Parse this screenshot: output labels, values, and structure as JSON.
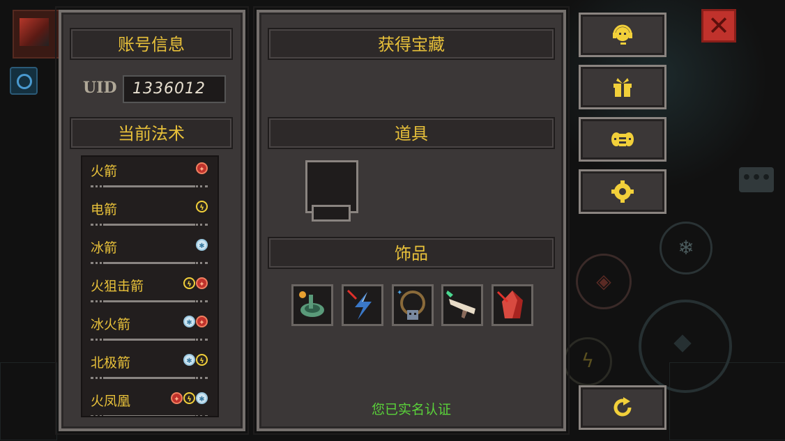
{
  "account": {
    "title": "账号信息",
    "uid_label": "UID",
    "uid_value": "1336012"
  },
  "spells": {
    "title": "当前法术",
    "items": [
      {
        "name": "火箭",
        "elements": [
          "fire"
        ]
      },
      {
        "name": "电箭",
        "elements": [
          "thunder"
        ]
      },
      {
        "name": "冰箭",
        "elements": [
          "ice"
        ]
      },
      {
        "name": "火狙击箭",
        "elements": [
          "thunder",
          "fire"
        ]
      },
      {
        "name": "冰火箭",
        "elements": [
          "ice",
          "fire"
        ]
      },
      {
        "name": "北极箭",
        "elements": [
          "ice",
          "thunder"
        ]
      },
      {
        "name": "火凤凰",
        "elements": [
          "fire",
          "thunder",
          "ice"
        ]
      }
    ]
  },
  "treasure": {
    "title": "获得宝藏",
    "props_title": "道具",
    "accessories_title": "饰品",
    "accessories": [
      {
        "icon": "coiled-snake-amulet-icon"
      },
      {
        "icon": "lightning-bolt-charm-icon"
      },
      {
        "icon": "skull-necklace-icon"
      },
      {
        "icon": "bone-horn-icon"
      },
      {
        "icon": "red-crystal-icon"
      }
    ],
    "verified_text": "您已实名认证"
  },
  "side_buttons": [
    {
      "icon": "customer-service-icon"
    },
    {
      "icon": "gift-icon"
    },
    {
      "icon": "bee-icon"
    },
    {
      "icon": "settings-gear-icon"
    },
    {
      "icon": "refresh-icon"
    }
  ],
  "colors": {
    "accent_gold": "#e8c13a",
    "verified_green": "#5ad23a",
    "close_red": "#c0322c"
  }
}
